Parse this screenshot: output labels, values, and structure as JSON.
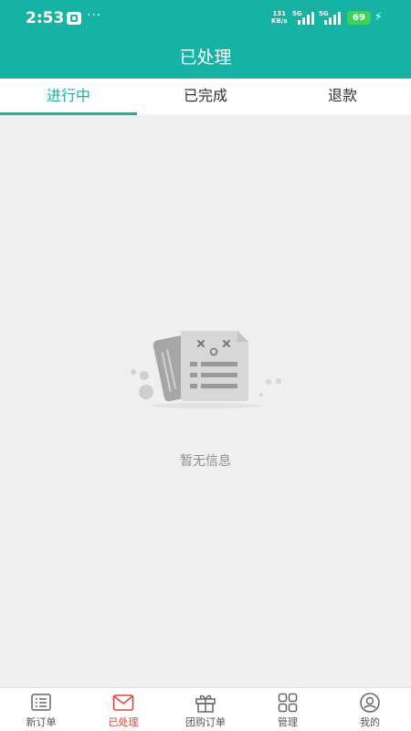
{
  "status_bar": {
    "time": "2:53",
    "more": "···",
    "net_speed_value": "131",
    "net_speed_unit": "KB/s",
    "sim1": "5G",
    "sim2": "5G",
    "battery": "69"
  },
  "header": {
    "title": "已处理"
  },
  "tabs": [
    {
      "label": "进行中",
      "active": true
    },
    {
      "label": "已完成",
      "active": false
    },
    {
      "label": "退款",
      "active": false
    }
  ],
  "empty_state": {
    "text": "暂无信息"
  },
  "bottom_nav": [
    {
      "label": "新订单",
      "icon": "order-list-icon",
      "active": false
    },
    {
      "label": "已处理",
      "icon": "mail-icon",
      "active": true
    },
    {
      "label": "团购订单",
      "icon": "gift-icon",
      "active": false
    },
    {
      "label": "管理",
      "icon": "grid-icon",
      "active": false
    },
    {
      "label": "我的",
      "icon": "profile-icon",
      "active": false
    }
  ],
  "colors": {
    "primary": "#16b3a5",
    "active_nav": "#e0443e",
    "background": "#efefef"
  }
}
